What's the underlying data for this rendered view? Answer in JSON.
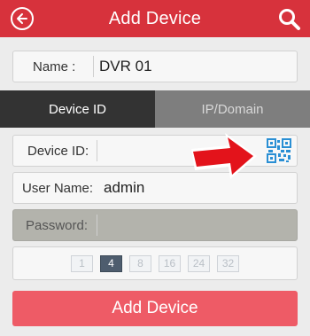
{
  "header": {
    "title": "Add Device",
    "back_icon": "back-arrow-circle-icon",
    "search_icon": "search-icon"
  },
  "name_field": {
    "label": "Name :",
    "value": "DVR 01"
  },
  "tabs": [
    {
      "label": "Device ID",
      "active": true
    },
    {
      "label": "IP/Domain",
      "active": false
    }
  ],
  "device_id_field": {
    "label": "Device ID:",
    "value": "",
    "scan_icon": "qr-code-icon"
  },
  "username_field": {
    "label": "User Name:",
    "value": "admin"
  },
  "password_field": {
    "label": "Password:",
    "value": ""
  },
  "channels": {
    "options": [
      "1",
      "4",
      "8",
      "16",
      "24",
      "32"
    ],
    "selected": "4"
  },
  "add_button": {
    "label": "Add Device"
  },
  "colors": {
    "header": "#d7323c",
    "button": "#ee5b66",
    "annotation_arrow": "#e3131b",
    "qr": "#2a8fd4"
  }
}
